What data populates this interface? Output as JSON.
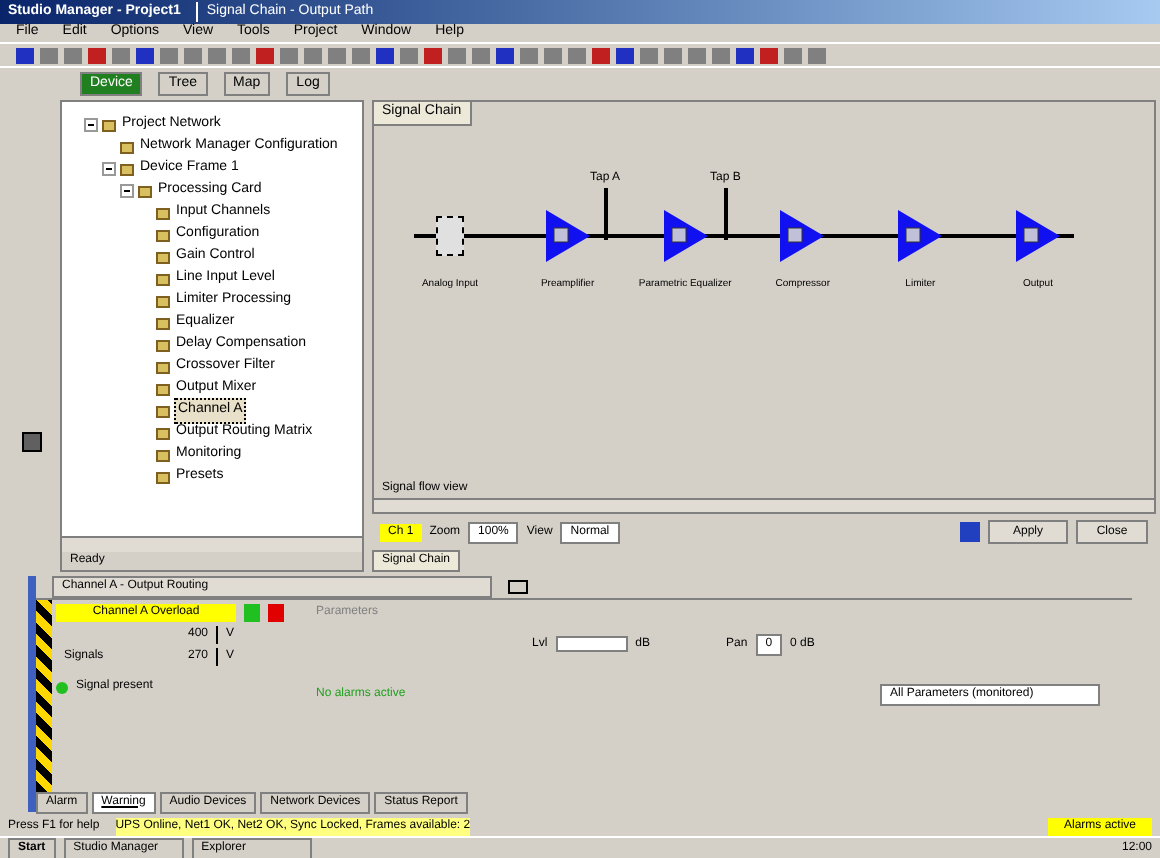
{
  "window": {
    "title": "Studio Manager - Project1",
    "doc_title": "Signal Chain - Output Path"
  },
  "menu": [
    "File",
    "Edit",
    "Options",
    "View",
    "Tools",
    "Project",
    "Window",
    "Help"
  ],
  "left_tabs": [
    {
      "label": "Device",
      "selected": true
    },
    {
      "label": "Tree",
      "selected": false
    },
    {
      "label": "Map",
      "selected": false
    },
    {
      "label": "Log",
      "selected": false
    }
  ],
  "tree": [
    {
      "label": "Project Network",
      "expanded": true,
      "children": [
        {
          "label": "Network Manager Configuration"
        },
        {
          "label": "Device Frame 1",
          "expanded": true,
          "children": [
            {
              "label": "Processing Card",
              "expanded": true,
              "children": [
                {
                  "label": "Input Channels",
                  "selected": false
                },
                {
                  "label": "Configuration",
                  "selected": false
                },
                {
                  "label": "Gain Control",
                  "selected": false
                },
                {
                  "label": "Line Input Level",
                  "selected": false
                },
                {
                  "label": "Limiter Processing",
                  "selected": false
                },
                {
                  "label": "Equalizer",
                  "selected": false
                },
                {
                  "label": "Delay Compensation",
                  "selected": false
                },
                {
                  "label": "Crossover Filter",
                  "selected": false
                },
                {
                  "label": "Output Mixer",
                  "selected": false
                },
                {
                  "label": "Channel A",
                  "selected": true
                },
                {
                  "label": "Output Routing Matrix",
                  "selected": false
                },
                {
                  "label": "Monitoring",
                  "selected": false
                },
                {
                  "label": "Presets",
                  "selected": false
                }
              ]
            }
          ]
        }
      ]
    }
  ],
  "tree_footer": "Ready",
  "diagram": {
    "tab": "Signal Chain",
    "taps": [
      "Tap A",
      "Tap B"
    ],
    "nodes": [
      {
        "kind": "source",
        "label": "Analog Input"
      },
      {
        "kind": "block",
        "label": "Preamplifier"
      },
      {
        "kind": "block",
        "label": "Parametric Equalizer"
      },
      {
        "kind": "block",
        "label": "Compressor"
      },
      {
        "kind": "block",
        "label": "Limiter"
      },
      {
        "kind": "block",
        "label": "Output"
      }
    ],
    "footer": "Signal flow view"
  },
  "diagram_controls": {
    "channel": "Ch 1",
    "zoom_label": "Zoom",
    "zoom": "100%",
    "view_label": "View",
    "view": "Normal",
    "apply": "Apply",
    "close": "Close"
  },
  "doc_tab": "Signal Chain",
  "bottom": {
    "toolbar_field": "Channel A - Output Routing",
    "alarm": "Channel A Overload",
    "codes": [
      "400",
      "270"
    ],
    "units": [
      "V",
      "V"
    ],
    "row_label": "Signals",
    "status": "Signal present",
    "green_text": "No alarms active",
    "group": "Parameters",
    "level_label": "Lvl",
    "level_unit": "dB",
    "pan_label": "Pan",
    "pan_value": "0",
    "pan_unit": "0 dB",
    "dropdown": "All Parameters (monitored)"
  },
  "bottom_tabs": [
    {
      "label": "Alarm",
      "selected": false
    },
    {
      "label": "Warning",
      "selected": true
    },
    {
      "label": "Audio Devices",
      "selected": false
    },
    {
      "label": "Network Devices",
      "selected": false
    },
    {
      "label": "Status Report",
      "selected": false
    }
  ],
  "status_bar": {
    "left": "Press F1 for help",
    "middle": "UPS Online, Net1 OK, Net2 OK, Sync Locked, Frames available: 2",
    "right": "Alarms active"
  },
  "taskbar": {
    "start": "Start",
    "items": [
      "Studio Manager",
      "Explorer"
    ],
    "clock": "12:00"
  }
}
